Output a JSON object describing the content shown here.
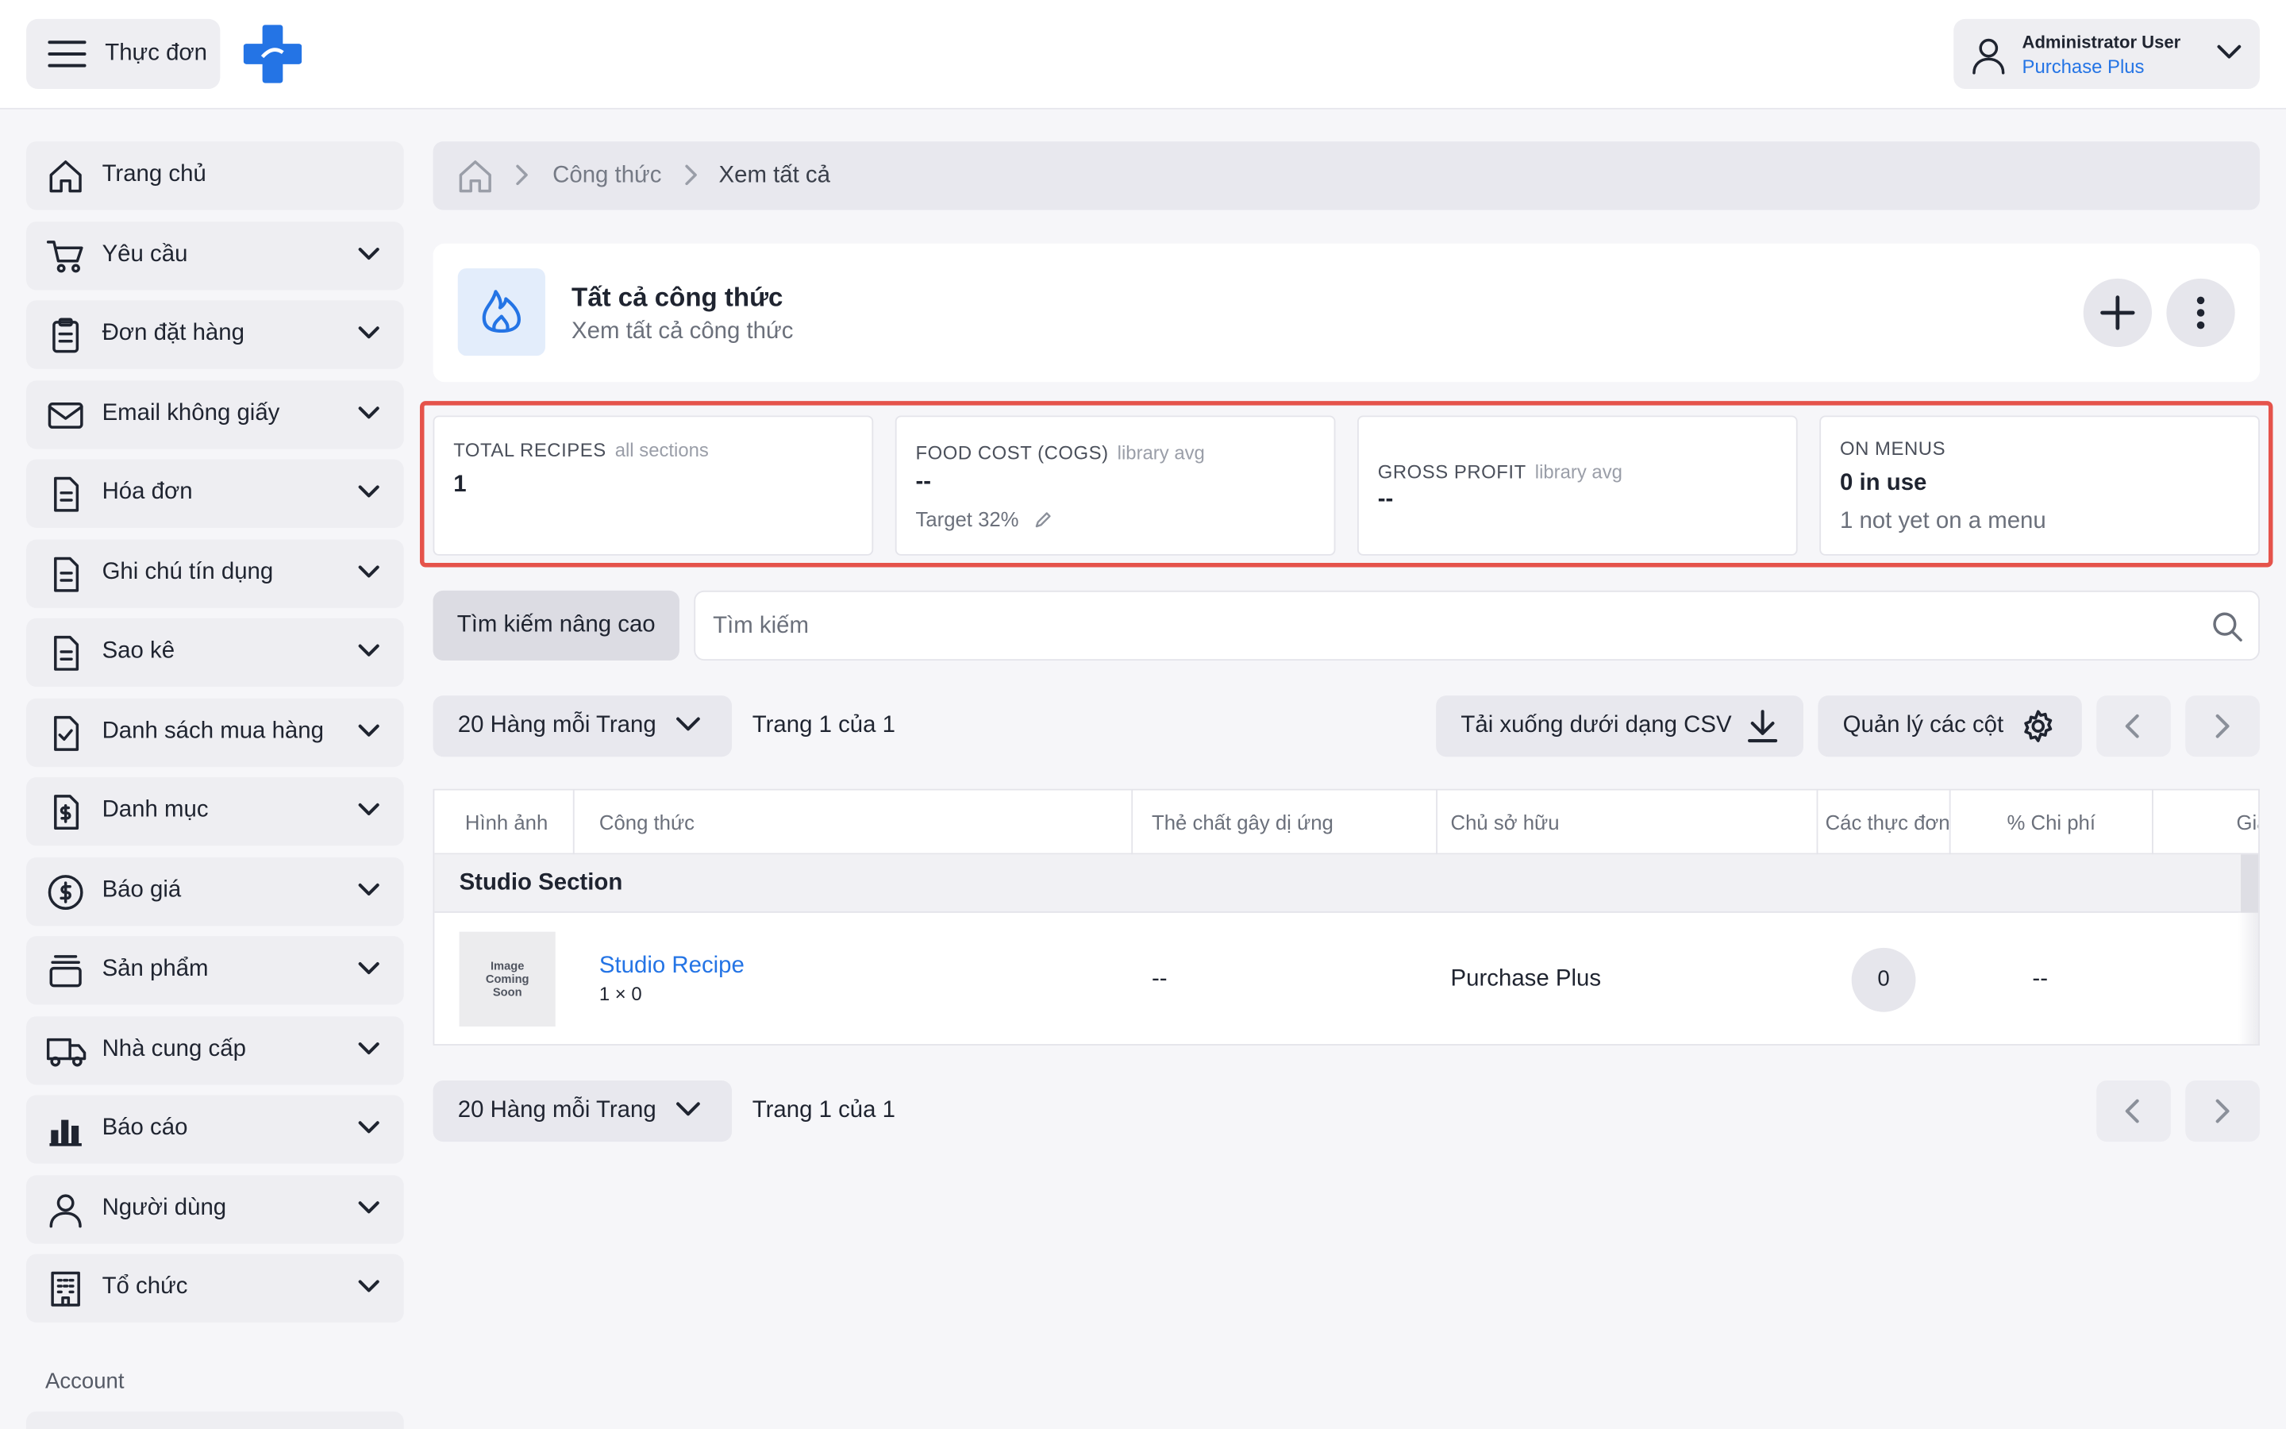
{
  "topbar": {
    "menu_label": "Thực đơn",
    "user_name": "Administrator User",
    "user_org": "Purchase Plus"
  },
  "sidebar": {
    "items": [
      {
        "label": "Trang chủ",
        "icon": "home-icon"
      },
      {
        "label": "Yêu cầu",
        "icon": "cart-icon"
      },
      {
        "label": "Đơn đặt hàng",
        "icon": "clipboard-icon"
      },
      {
        "label": "Email không giấy",
        "icon": "mail-icon"
      },
      {
        "label": "Hóa đơn",
        "icon": "document-icon"
      },
      {
        "label": "Ghi chú tín dụng",
        "icon": "document-icon"
      },
      {
        "label": "Sao kê",
        "icon": "document-icon"
      },
      {
        "label": "Danh sách mua hàng",
        "icon": "checklist-icon"
      },
      {
        "label": "Danh mục",
        "icon": "dollar-document-icon"
      },
      {
        "label": "Báo giá",
        "icon": "dollar-circle-icon"
      },
      {
        "label": "Sản phẩm",
        "icon": "stack-icon"
      },
      {
        "label": "Nhà cung cấp",
        "icon": "truck-icon"
      },
      {
        "label": "Báo cáo",
        "icon": "bar-chart-icon"
      },
      {
        "label": "Người dùng",
        "icon": "user-icon"
      },
      {
        "label": "Tổ chức",
        "icon": "building-icon"
      }
    ],
    "section_label": "Account"
  },
  "breadcrumb": {
    "items": [
      "Công thức",
      "Xem tất cả"
    ]
  },
  "header": {
    "title": "Tất cả công thức",
    "subtitle": "Xem tất cả công thức"
  },
  "stats": {
    "total_recipes": {
      "label": "TOTAL RECIPES",
      "muted": "all sections",
      "value": "1"
    },
    "food_cost": {
      "label": "FOOD COST (COGS)",
      "muted": "library avg",
      "value": "--",
      "note": "Target 32%"
    },
    "gross_profit": {
      "label": "GROSS PROFIT",
      "muted": "library avg",
      "value": "--"
    },
    "on_menus": {
      "label": "ON MENUS",
      "value": "0 in use",
      "note": "1 not yet on a menu"
    }
  },
  "search": {
    "advanced_label": "Tìm kiếm nâng cao",
    "placeholder": "Tìm kiếm"
  },
  "pagination": {
    "rows_per_page_label": "20 Hàng mỗi Trang",
    "page_text": "Trang 1 của 1"
  },
  "toolbar": {
    "download_label": "Tải xuống dưới dạng CSV",
    "columns_label": "Quản lý các cột"
  },
  "table": {
    "headers": [
      "Hình ảnh",
      "Công thức",
      "Thẻ chất gây dị ứng",
      "Chủ sở hữu",
      "Các thực đơn",
      "% Chi phí",
      "Giá"
    ],
    "section_label": "Studio Section",
    "rows": [
      {
        "image_text": [
          "Image",
          "Coming",
          "Soon"
        ],
        "recipe": "Studio Recipe",
        "recipe_sub": "1 × 0",
        "allergens": "--",
        "owner": "Purchase Plus",
        "menus": "0",
        "cost_pct": "--"
      }
    ]
  },
  "colors": {
    "accent": "#2474e5",
    "highlight_frame": "#e5534b",
    "background": "#f6f6f9"
  }
}
